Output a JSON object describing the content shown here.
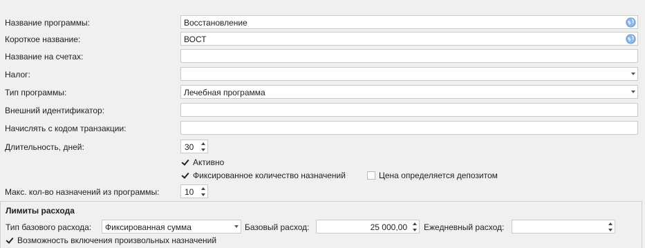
{
  "form": {
    "program_name": {
      "label": "Название программы:",
      "value": "Восстановление"
    },
    "short_name": {
      "label": "Короткое название:",
      "value": "ВОСТ"
    },
    "invoice_name": {
      "label": "Название на счетах:",
      "value": ""
    },
    "tax": {
      "label": "Налог:",
      "value": ""
    },
    "program_type": {
      "label": "Тип программы:",
      "value": "Лечебная программа"
    },
    "external_id": {
      "label": "Внешний идентификатор:",
      "value": ""
    },
    "transaction_code": {
      "label": "Начислять с кодом транзакции:",
      "value": ""
    },
    "duration": {
      "label": "Длительность, дней:",
      "value": "30"
    },
    "active": {
      "label": "Активно",
      "checked": true
    },
    "fixed_count": {
      "label": "Фиксированное количество назначений",
      "checked": true
    },
    "price_by_deposit": {
      "label": "Цена определяется депозитом",
      "checked": false
    },
    "max_count": {
      "label": "Макс. кол-во назначений из программы:",
      "value": "10"
    }
  },
  "limits": {
    "title": "Лимиты расхода",
    "base_type": {
      "label": "Тип базового расхода:",
      "value": "Фиксированная сумма"
    },
    "base_amount": {
      "label": "Базовый расход:",
      "value": "25 000,00"
    },
    "daily_amount": {
      "label": "Ежедневный расход:",
      "value": ""
    },
    "allow_custom": {
      "label": "Возможность включения произвольных назначений",
      "checked": true
    }
  },
  "icons": {
    "translate": "globe-icon",
    "dropdown": "chevron-down-icon",
    "spinner": "spinner-arrows-icon",
    "check": "check-icon"
  }
}
